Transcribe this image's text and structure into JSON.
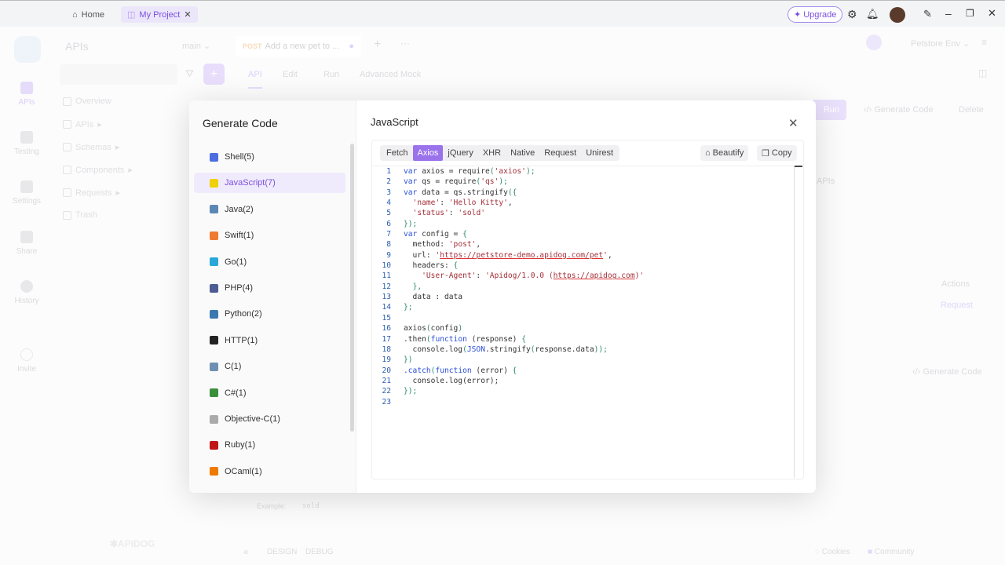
{
  "titlebar": {
    "home": "Home",
    "project_tab": "My Project",
    "upgrade": "Upgrade"
  },
  "sidebar": {
    "items": [
      {
        "label": "APIs"
      },
      {
        "label": "Testing"
      },
      {
        "label": "Settings"
      },
      {
        "label": "Share"
      },
      {
        "label": "History"
      },
      {
        "label": "Invite"
      }
    ]
  },
  "tree": {
    "title": "APIs",
    "branch": "main",
    "items": [
      "Overview",
      "APIs",
      "Schemas",
      "Components",
      "Requests",
      "Trash"
    ]
  },
  "editor": {
    "method": "POST",
    "tab_title": "Add a new pet to ...",
    "subtabs": [
      "API",
      "Edit",
      "Run",
      "Advanced Mock"
    ],
    "env": "Petstore Env",
    "run": "Run",
    "generate_code": "Generate Code",
    "delete": "Delete",
    "apis_text": "APIs",
    "actions": "Actions",
    "request": "Request",
    "generate_code2": "Generate Code",
    "example_label": "Example:",
    "example_value": "sold"
  },
  "footer": {
    "design": "DESIGN",
    "debug": "DEBUG",
    "cookies": "Cookies",
    "community": "Community"
  },
  "modal": {
    "title": "Generate Code",
    "lang_title": "JavaScript",
    "languages": [
      {
        "label": "Shell(5)",
        "color": "#4a6ee0"
      },
      {
        "label": "JavaScript(7)",
        "color": "#f0d000"
      },
      {
        "label": "Java(2)",
        "color": "#5b87b5"
      },
      {
        "label": "Swift(1)",
        "color": "#f07a30"
      },
      {
        "label": "Go(1)",
        "color": "#29a8d8"
      },
      {
        "label": "PHP(4)",
        "color": "#4f5b93"
      },
      {
        "label": "Python(2)",
        "color": "#3a78b0"
      },
      {
        "label": "HTTP(1)",
        "color": "#222"
      },
      {
        "label": "C(1)",
        "color": "#6f8fb0"
      },
      {
        "label": "C#(1)",
        "color": "#3b8f3b"
      },
      {
        "label": "Objective-C(1)",
        "color": "#aaa"
      },
      {
        "label": "Ruby(1)",
        "color": "#c01515"
      },
      {
        "label": "OCaml(1)",
        "color": "#ee7a00"
      }
    ],
    "selected_language": "JavaScript(7)",
    "variants": [
      "Fetch",
      "Axios",
      "jQuery",
      "XHR",
      "Native",
      "Request",
      "Unirest"
    ],
    "selected_variant": "Axios",
    "beautify": "Beautify",
    "copy": "Copy",
    "code": [
      [
        [
          "var",
          "kw"
        ],
        [
          " axios = require",
          ""
        ],
        [
          "(",
          "br"
        ],
        [
          "'axios'",
          "str"
        ],
        [
          ");",
          "br"
        ]
      ],
      [
        [
          "var",
          "kw"
        ],
        [
          " qs = require",
          ""
        ],
        [
          "(",
          "br"
        ],
        [
          "'qs'",
          "str"
        ],
        [
          ");",
          "br"
        ]
      ],
      [
        [
          "var",
          "kw"
        ],
        [
          " data = qs.stringify",
          ""
        ],
        [
          "({",
          "br"
        ]
      ],
      [
        [
          "  ",
          ""
        ],
        [
          "'name'",
          "str"
        ],
        [
          ": ",
          ""
        ],
        [
          "'Hello Kitty'",
          "str"
        ],
        [
          ",",
          ""
        ]
      ],
      [
        [
          "  ",
          ""
        ],
        [
          "'status'",
          "str"
        ],
        [
          ": ",
          ""
        ],
        [
          "'sold'",
          "str"
        ]
      ],
      [
        [
          "});",
          "br"
        ]
      ],
      [
        [
          "var",
          "kw"
        ],
        [
          " config = ",
          ""
        ],
        [
          "{",
          "br"
        ]
      ],
      [
        [
          "  method: ",
          ""
        ],
        [
          "'post'",
          "str"
        ],
        [
          ",",
          ""
        ]
      ],
      [
        [
          "  url: ",
          ""
        ],
        [
          "'",
          "str"
        ],
        [
          "https://petstore-demo.apidog.com/pet",
          "url"
        ],
        [
          "'",
          "str"
        ],
        [
          ",",
          ""
        ]
      ],
      [
        [
          "  headers: ",
          ""
        ],
        [
          "{",
          "br"
        ]
      ],
      [
        [
          "    ",
          ""
        ],
        [
          "'User-Agent'",
          "str"
        ],
        [
          ": ",
          ""
        ],
        [
          "'Apidog/1.0.0 (",
          "str"
        ],
        [
          "https://apidog.com",
          "url"
        ],
        [
          ")'",
          "str"
        ]
      ],
      [
        [
          "  ",
          ""
        ],
        [
          "},",
          "br"
        ]
      ],
      [
        [
          "  data : data",
          ""
        ]
      ],
      [
        [
          "};",
          "br"
        ]
      ],
      [
        [
          "",
          ""
        ]
      ],
      [
        [
          "axios",
          ""
        ],
        [
          "(",
          "br"
        ],
        [
          "config",
          ""
        ],
        [
          ")",
          "br"
        ]
      ],
      [
        [
          ".then",
          ""
        ],
        [
          "(",
          "br"
        ],
        [
          "function",
          "fn"
        ],
        [
          " (response) ",
          ""
        ],
        [
          "{",
          "br"
        ]
      ],
      [
        [
          "  console.log",
          ""
        ],
        [
          "(",
          "br"
        ],
        [
          "JSON",
          "fn"
        ],
        [
          ".stringify",
          ""
        ],
        [
          "(",
          "br"
        ],
        [
          "response.data",
          ""
        ],
        [
          "));",
          "br"
        ]
      ],
      [
        [
          "})",
          "br"
        ]
      ],
      [
        [
          ".catch",
          "fn"
        ],
        [
          "(",
          "br"
        ],
        [
          "function",
          "fn"
        ],
        [
          " (error) ",
          ""
        ],
        [
          "{",
          "br"
        ]
      ],
      [
        [
          "  console.log(error);",
          ""
        ]
      ],
      [
        [
          "});",
          "br"
        ]
      ],
      [
        [
          "",
          ""
        ]
      ]
    ]
  }
}
